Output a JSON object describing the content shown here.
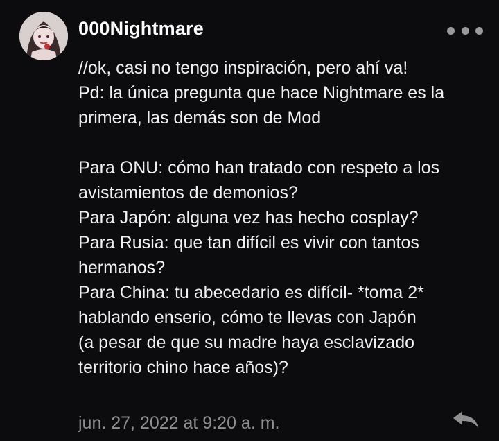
{
  "comment": {
    "username": "000Nightmare",
    "more_icon": "more-horizontal-icon",
    "lines": [
      "//ok, casi no tengo inspiración, pero ahí va!",
      "Pd: la única pregunta que hace Nightmare es la",
      "primera, las demás son de Mod",
      "",
      "Para ONU: cómo han tratado con respeto a los",
      "avistamientos de demonios?",
      "Para Japón: alguna vez has hecho cosplay?",
      "Para Rusia: que tan difícil es vivir con tantos",
      "hermanos?",
      "Para China: tu abecedario es difícil- *toma 2*",
      "hablando enserio, cómo te llevas con Japón",
      "(a pesar de que su madre haya esclavizado",
      "territorio chino hace años)?"
    ],
    "timestamp": "jun. 27, 2022 at 9:20 a. m.",
    "reply_icon": "reply-arrow-icon"
  },
  "colors": {
    "background": "#0c0c0e",
    "text": "#f0f0f0",
    "muted": "#8f8f8f"
  }
}
